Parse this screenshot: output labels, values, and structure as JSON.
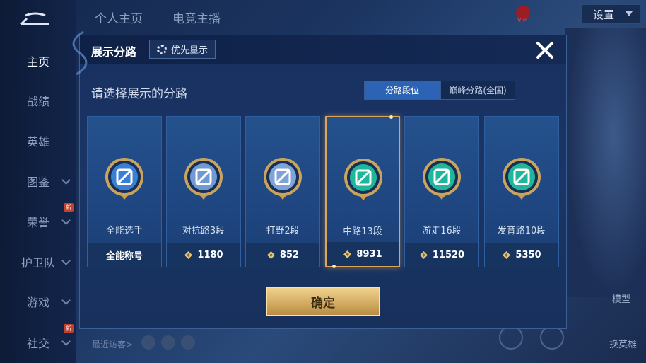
{
  "top_tabs": [
    "个人主页",
    "电竞主播"
  ],
  "sidebar": {
    "items": [
      {
        "label": "主页",
        "active": true,
        "chevron": false,
        "new_badge": false
      },
      {
        "label": "战绩",
        "active": false,
        "chevron": false,
        "new_badge": false
      },
      {
        "label": "英雄",
        "active": false,
        "chevron": false,
        "new_badge": false
      },
      {
        "label": "图鉴",
        "active": false,
        "chevron": true,
        "new_badge": false
      },
      {
        "label": "荣誉",
        "active": false,
        "chevron": true,
        "new_badge": true
      },
      {
        "label": "护卫队",
        "active": false,
        "chevron": true,
        "new_badge": false
      },
      {
        "label": "游戏",
        "active": false,
        "chevron": true,
        "new_badge": false
      },
      {
        "label": "社交",
        "active": false,
        "chevron": true,
        "new_badge": true
      }
    ],
    "new_badge_text": "新"
  },
  "settings_label": "设置",
  "vip_label": "VIP",
  "recent_visitors_label": "最近访客>",
  "right_labels": {
    "model": "模型",
    "switch_hero": "换英雄"
  },
  "dialog": {
    "title": "展示分路",
    "priority_button": "优先显示",
    "subtitle": "请选择展示的分路",
    "segments": {
      "active": "分路段位",
      "inactive": "巅峰分路(全国)"
    },
    "cards": [
      {
        "name": "全能选手",
        "foot": "全能称号",
        "points": false,
        "selected": false,
        "color": "#3a7fd6",
        "icon": "all-round-emblem-icon"
      },
      {
        "name": "对抗路3段",
        "foot": "1180",
        "points": true,
        "selected": false,
        "color": "#6f9ad3",
        "icon": "clash-lane-emblem-icon"
      },
      {
        "name": "打野2段",
        "foot": "852",
        "points": true,
        "selected": false,
        "color": "#7ea3d8",
        "icon": "jungle-emblem-icon"
      },
      {
        "name": "中路13段",
        "foot": "8931",
        "points": true,
        "selected": true,
        "color": "#1fb79c",
        "icon": "mid-lane-emblem-icon"
      },
      {
        "name": "游走16段",
        "foot": "11520",
        "points": true,
        "selected": false,
        "color": "#1fb79c",
        "icon": "roam-emblem-icon"
      },
      {
        "name": "发育路10段",
        "foot": "5350",
        "points": true,
        "selected": false,
        "color": "#1fb79c",
        "icon": "farm-lane-emblem-icon"
      }
    ],
    "confirm_label": "确定"
  },
  "colors": {
    "gold": "#d9a65a",
    "segment_active": "#2d63b5",
    "dialog_bg": "#18305f"
  }
}
